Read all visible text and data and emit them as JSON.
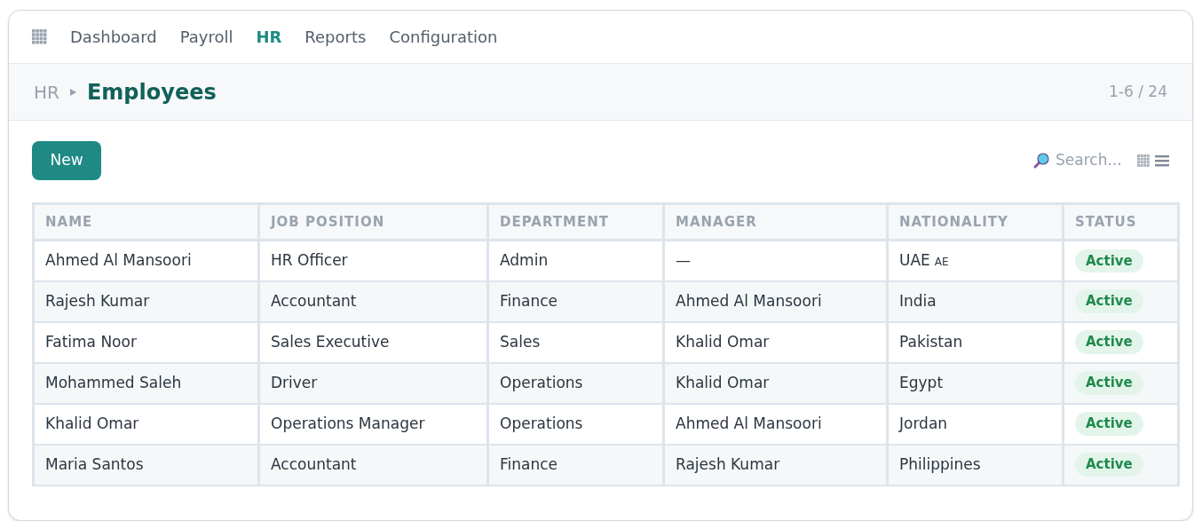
{
  "nav": {
    "items": [
      {
        "label": "Dashboard",
        "selected": false
      },
      {
        "label": "Payroll",
        "selected": false
      },
      {
        "label": "HR",
        "selected": true
      },
      {
        "label": "Reports",
        "selected": false
      },
      {
        "label": "Configuration",
        "selected": false
      }
    ]
  },
  "breadcrumb": {
    "parent": "HR",
    "current": "Employees"
  },
  "pager": "1-6 / 24",
  "new_button": "New",
  "search": {
    "placeholder": "Search..."
  },
  "view_switch": [
    {
      "kind": "grid",
      "selected": false
    },
    {
      "kind": "list",
      "selected": true
    }
  ],
  "table": {
    "columns": [
      "NAME",
      "JOB POSITION",
      "DEPARTMENT",
      "MANAGER",
      "NATIONALITY",
      "STATUS"
    ],
    "rows": [
      {
        "name": "Ahmed Al Mansoori",
        "job": "HR Officer",
        "department": "Admin",
        "manager": "—",
        "nationality": "UAE",
        "flag_code": "AE",
        "status": "Active",
        "color": "#1f8a4c"
      },
      {
        "name": "Rajesh Kumar",
        "job": "Accountant",
        "department": "Finance",
        "manager": "Ahmed Al Mansoori",
        "nationality": "India",
        "status": "Active",
        "color": "#1f8a4c"
      },
      {
        "name": "Fatima Noor",
        "job": "Sales Executive",
        "department": "Sales",
        "manager": "Khalid Omar",
        "nationality": "Pakistan",
        "status": "Active",
        "color": "#1f8a4c"
      },
      {
        "name": "Mohammed Saleh",
        "job": "Driver",
        "department": "Operations",
        "manager": "Khalid Omar",
        "nationality": "Egypt",
        "status": "Active",
        "color": "#1f8a4c"
      },
      {
        "name": "Khalid Omar",
        "job": "Operations Manager",
        "department": "Operations",
        "manager": "Ahmed Al Mansoori",
        "nationality": "Jordan",
        "status": "Active",
        "color": "#1f8a4c"
      },
      {
        "name": "Maria Santos",
        "job": "Accountant",
        "department": "Finance",
        "manager": "Rajesh Kumar",
        "nationality": "Philippines",
        "status": "Active",
        "color": "#1f8a4c"
      }
    ]
  }
}
